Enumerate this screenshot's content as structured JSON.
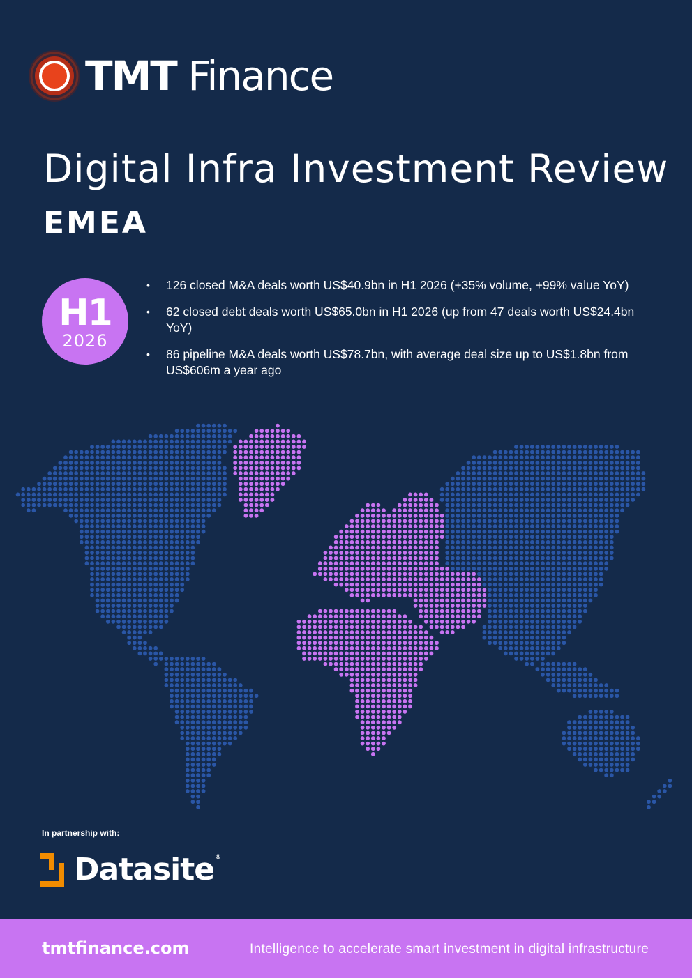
{
  "brand": {
    "logo_bold": "TMT",
    "logo_light": "Finance",
    "logo_icon": "target-circle-icon",
    "accent": "#e8431c"
  },
  "report": {
    "title": "Digital Infra Investment Review",
    "region": "EMEA"
  },
  "period": {
    "half": "H1",
    "year": "2026"
  },
  "highlights": [
    "126 closed M&A deals worth US$40.9bn in H1 2026 (+35% volume, +99% value YoY)",
    "62 closed debt deals worth US$65.0bn in H1 2026 (up from 47 deals worth US$24.4bn YoY)",
    "86 pipeline M&A deals worth US$78.7bn, with average deal size up to US$1.8bn from US$606m a year ago"
  ],
  "partner": {
    "label": "In partnership with:",
    "name": "Datasite",
    "registered_mark": "®",
    "icon": "datasite-bracket-icon",
    "accent": "#f28c00"
  },
  "footer": {
    "url": "tmtfinance.com",
    "tagline": "Intelligence to accelerate smart investment in digital infrastructure"
  },
  "colors": {
    "background": "#142a4a",
    "highlight": "#c874f2",
    "map_rest": "#2a56a6"
  }
}
